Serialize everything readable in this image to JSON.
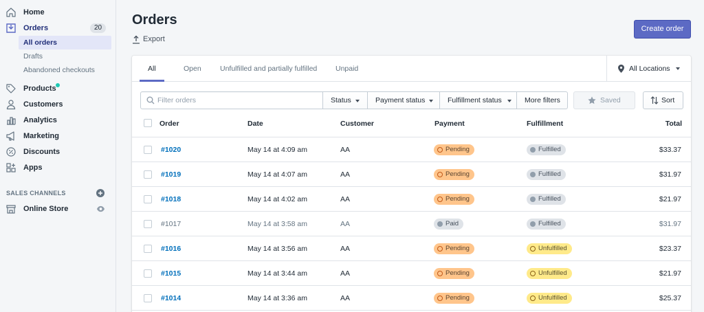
{
  "sidebar": {
    "home": "Home",
    "orders": "Orders",
    "orders_count": "20",
    "sub": [
      "All orders",
      "Drafts",
      "Abandoned checkouts"
    ],
    "products": "Products",
    "customers": "Customers",
    "analytics": "Analytics",
    "marketing": "Marketing",
    "discounts": "Discounts",
    "apps": "Apps",
    "sales_channels": "SALES CHANNELS",
    "online_store": "Online Store"
  },
  "header": {
    "title": "Orders",
    "export": "Export",
    "create_order": "Create order"
  },
  "tabs": [
    "All",
    "Open",
    "Unfulfilled and partially fulfilled",
    "Unpaid"
  ],
  "location": "All Locations",
  "filters": {
    "placeholder": "Filter orders",
    "status": "Status",
    "payment_status": "Payment status",
    "fulfillment_status": "Fulfillment status",
    "more_filters": "More filters",
    "saved": "Saved",
    "sort": "Sort"
  },
  "table": {
    "headers": [
      "Order",
      "Date",
      "Customer",
      "Payment",
      "Fulfillment",
      "Total"
    ],
    "rows": [
      {
        "order": "#1020",
        "date": "May 14 at 4:09 am",
        "customer": "AA",
        "payment": "Pending",
        "fulfillment": "Fulfilled",
        "total": "$33.37"
      },
      {
        "order": "#1019",
        "date": "May 14 at 4:07 am",
        "customer": "AA",
        "payment": "Pending",
        "fulfillment": "Fulfilled",
        "total": "$31.97"
      },
      {
        "order": "#1018",
        "date": "May 14 at 4:02 am",
        "customer": "AA",
        "payment": "Pending",
        "fulfillment": "Fulfilled",
        "total": "$21.97"
      },
      {
        "order": "#1017",
        "date": "May 14 at 3:58 am",
        "customer": "AA",
        "payment": "Paid",
        "fulfillment": "Fulfilled",
        "total": "$31.97"
      },
      {
        "order": "#1016",
        "date": "May 14 at 3:56 am",
        "customer": "AA",
        "payment": "Pending",
        "fulfillment": "Unfulfilled",
        "total": "$23.37"
      },
      {
        "order": "#1015",
        "date": "May 14 at 3:44 am",
        "customer": "AA",
        "payment": "Pending",
        "fulfillment": "Unfulfilled",
        "total": "$21.97"
      },
      {
        "order": "#1014",
        "date": "May 14 at 3:36 am",
        "customer": "AA",
        "payment": "Pending",
        "fulfillment": "Unfulfilled",
        "total": "$25.37"
      }
    ]
  },
  "colors": {
    "accent": "#5c6ac4",
    "link": "#006fbb",
    "pending": "#ffc58b",
    "unfulfilled": "#ffea8a",
    "neutral_badge": "#dfe3e8",
    "new_dot": "#1fc9b4"
  }
}
